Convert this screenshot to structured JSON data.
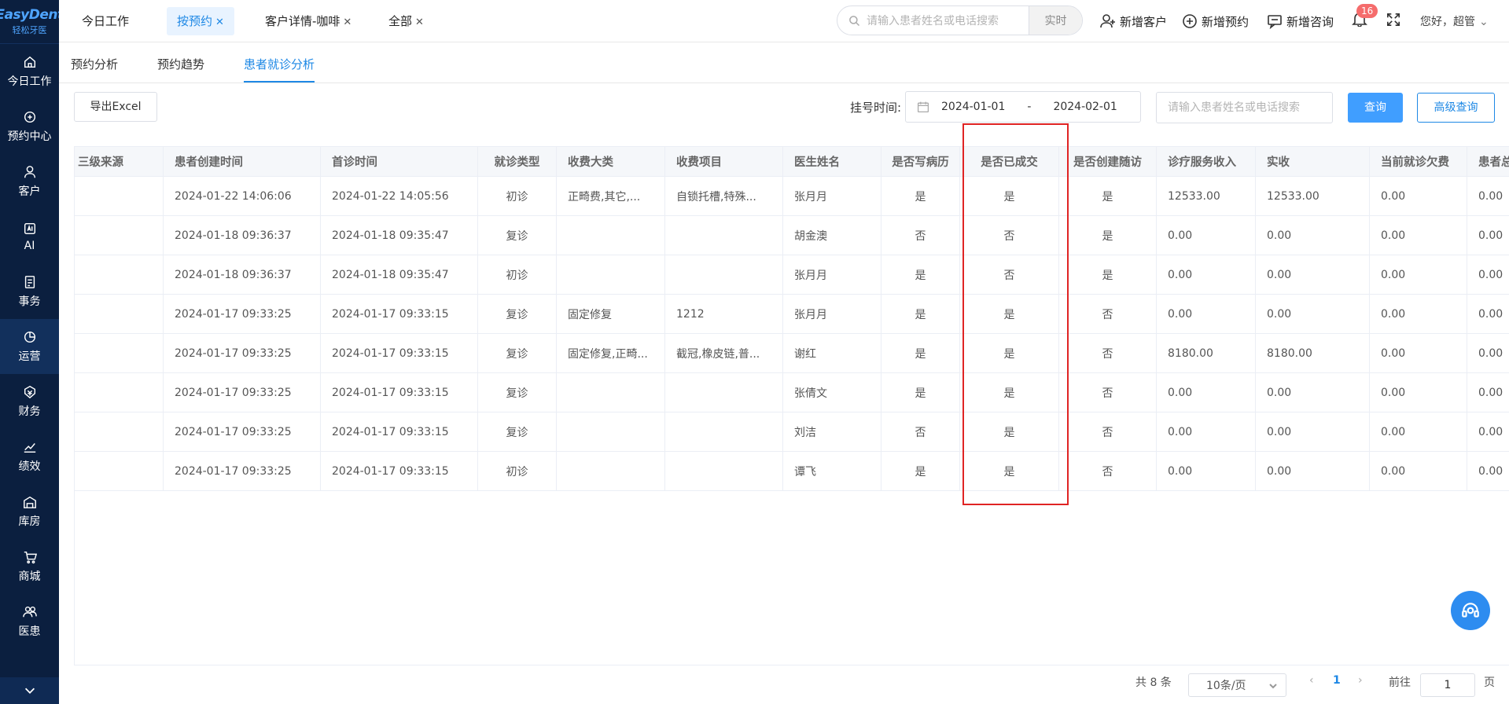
{
  "app": {
    "logo_top": "EasyDent",
    "logo_bottom": "轻松牙医"
  },
  "sidebar": {
    "items": [
      {
        "label": "今日工作",
        "icon": "home-icon"
      },
      {
        "label": "预约中心",
        "icon": "appointment-icon"
      },
      {
        "label": "客户",
        "icon": "user-icon"
      },
      {
        "label": "AI",
        "icon": "ai-icon"
      },
      {
        "label": "事务",
        "icon": "task-icon"
      },
      {
        "label": "运营",
        "icon": "pie-chart-icon",
        "active": true
      },
      {
        "label": "财务",
        "icon": "finance-icon"
      },
      {
        "label": "绩效",
        "icon": "trend-icon"
      },
      {
        "label": "库房",
        "icon": "warehouse-icon"
      },
      {
        "label": "商城",
        "icon": "cart-icon"
      },
      {
        "label": "医患",
        "icon": "doctor-patient-icon"
      }
    ]
  },
  "tabs": [
    {
      "label": "今日工作",
      "closable": false
    },
    {
      "label": "按预约",
      "closable": true,
      "active": true
    },
    {
      "label": "客户详情-咖啡",
      "closable": true
    },
    {
      "label": "全部",
      "closable": true
    }
  ],
  "header": {
    "search_placeholder": "请输入患者姓名或电话搜索",
    "search_mode": "实时",
    "new_customer": "新增客户",
    "new_appointment": "新增预约",
    "new_consult": "新增咨询",
    "notifications": "16",
    "greeting": "您好，超管"
  },
  "subtabs": [
    "预约分析",
    "预约趋势",
    "患者就诊分析"
  ],
  "filters": {
    "export_label": "导出Excel",
    "date_label": "挂号时间:",
    "date_start": "2024-01-01",
    "date_sep": "-",
    "date_end": "2024-02-01",
    "search_placeholder": "请输入患者姓名或电话搜索",
    "query_label": "查询",
    "advanced_label": "高级查询"
  },
  "table": {
    "columns": [
      "三级来源",
      "患者创建时间",
      "首诊时间",
      "就诊类型",
      "收费大类",
      "收费项目",
      "医生姓名",
      "是否写病历",
      "是否已成交",
      "是否创建随访",
      "诊疗服务收入",
      "实收",
      "当前就诊欠费",
      "患者总"
    ],
    "rows": [
      [
        "",
        "2024-01-22 14:06:06",
        "2024-01-22 14:05:56",
        "初诊",
        "正畸费,其它,...",
        "自锁托槽,特殊...",
        "张月月",
        "是",
        "是",
        "是",
        "12533.00",
        "12533.00",
        "0.00",
        "0.00"
      ],
      [
        "",
        "2024-01-18 09:36:37",
        "2024-01-18 09:35:47",
        "复诊",
        "",
        "",
        "胡金澳",
        "否",
        "否",
        "是",
        "0.00",
        "0.00",
        "0.00",
        "0.00"
      ],
      [
        "",
        "2024-01-18 09:36:37",
        "2024-01-18 09:35:47",
        "初诊",
        "",
        "",
        "张月月",
        "是",
        "否",
        "是",
        "0.00",
        "0.00",
        "0.00",
        "0.00"
      ],
      [
        "",
        "2024-01-17 09:33:25",
        "2024-01-17 09:33:15",
        "复诊",
        "固定修复",
        "1212",
        "张月月",
        "是",
        "是",
        "否",
        "0.00",
        "0.00",
        "0.00",
        "0.00"
      ],
      [
        "",
        "2024-01-17 09:33:25",
        "2024-01-17 09:33:15",
        "复诊",
        "固定修复,正畸...",
        "截冠,橡皮链,普...",
        "谢红",
        "是",
        "是",
        "否",
        "8180.00",
        "8180.00",
        "0.00",
        "0.00"
      ],
      [
        "",
        "2024-01-17 09:33:25",
        "2024-01-17 09:33:15",
        "复诊",
        "",
        "",
        "张倩文",
        "是",
        "是",
        "否",
        "0.00",
        "0.00",
        "0.00",
        "0.00"
      ],
      [
        "",
        "2024-01-17 09:33:25",
        "2024-01-17 09:33:15",
        "复诊",
        "",
        "",
        "刘洁",
        "否",
        "是",
        "否",
        "0.00",
        "0.00",
        "0.00",
        "0.00"
      ],
      [
        "",
        "2024-01-17 09:33:25",
        "2024-01-17 09:33:15",
        "初诊",
        "",
        "",
        "谭飞",
        "是",
        "是",
        "否",
        "0.00",
        "0.00",
        "0.00",
        "0.00"
      ]
    ]
  },
  "pagination": {
    "total": "共 8 条",
    "page_size": "10条/页",
    "current": "1",
    "goto_label": "前往",
    "goto_value": "1",
    "page_suffix": "页"
  },
  "colors": {
    "accent": "#1e88e5",
    "sidebar_bg": "#0b1f3f",
    "highlight_box": "#e02424"
  }
}
